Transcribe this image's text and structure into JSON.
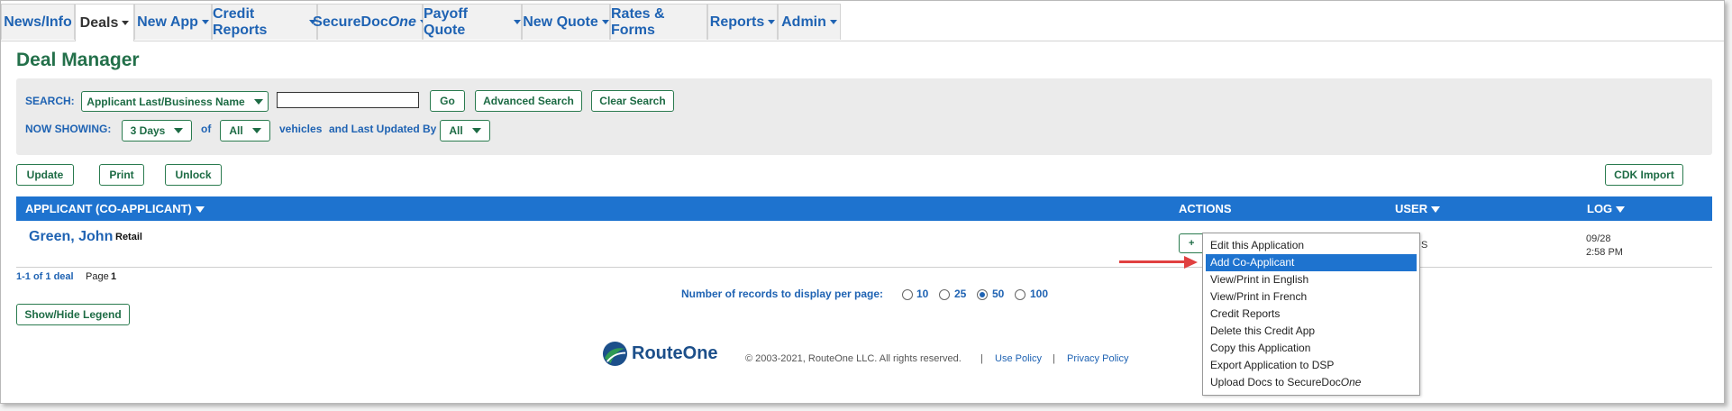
{
  "nav": {
    "tabs": [
      {
        "label": "News/Info",
        "caret": false,
        "active": false
      },
      {
        "label": "Deals",
        "caret": true,
        "active": true
      },
      {
        "label": "New App",
        "caret": true,
        "active": false
      },
      {
        "label": "Credit Reports",
        "caret": true,
        "active": false
      },
      {
        "label_prefix": "SecureDoc",
        "label_italic": "One",
        "caret": true,
        "active": false
      },
      {
        "label": "Payoff Quote",
        "caret": true,
        "active": false
      },
      {
        "label": "New Quote",
        "caret": true,
        "active": false
      },
      {
        "label": "Rates & Forms",
        "caret": false,
        "active": false
      },
      {
        "label": "Reports",
        "caret": true,
        "active": false
      },
      {
        "label": "Admin",
        "caret": true,
        "active": false
      }
    ]
  },
  "page": {
    "title": "Deal Manager"
  },
  "search": {
    "label": "SEARCH:",
    "field_selected": "Applicant Last/Business Name",
    "query_value": "",
    "go": "Go",
    "advanced": "Advanced Search",
    "clear": "Clear Search",
    "showing_label": "NOW SHOWING:",
    "days_selected": "3 Days",
    "of_label": "of",
    "vehicles_selected": "All",
    "vehicles_label": "vehicles",
    "updated_label": "and Last Updated By",
    "updated_by_selected": "All"
  },
  "toolbar": {
    "update": "Update",
    "print": "Print",
    "unlock": "Unlock",
    "cdk_import": "CDK Import"
  },
  "table": {
    "headers": {
      "applicant": "APPLICANT (CO-APPLICANT)",
      "actions": "ACTIONS",
      "user": "USER",
      "log": "LOG"
    },
    "rows": [
      {
        "applicant": "Green, John",
        "type": "Retail",
        "user": "US",
        "log_date": "09/28",
        "log_time": "2:58 PM"
      }
    ]
  },
  "action_button_partial": "+",
  "context_menu": {
    "items": [
      {
        "label": "Edit this Application"
      },
      {
        "label": "Add Co-Applicant",
        "highlighted": true
      },
      {
        "label": "View/Print in English"
      },
      {
        "label": "View/Print in French"
      },
      {
        "label": "Credit Reports"
      },
      {
        "label": "Delete this Credit App"
      },
      {
        "label": "Copy this Application"
      },
      {
        "label": "Export Application to DSP"
      },
      {
        "label_prefix": "Upload Docs to SecureDoc",
        "label_italic": "One"
      }
    ]
  },
  "pagination": {
    "count": "1-1 of 1 deal",
    "page_label": "Page",
    "page_number": "1"
  },
  "records": {
    "label": "Number of records to display per page:",
    "options": [
      "10",
      "25",
      "50",
      "100"
    ],
    "selected": "50"
  },
  "legend_button": "Show/Hide Legend",
  "footer": {
    "logo_text": "RouteOne",
    "copyright": "© 2003-2021, RouteOne LLC. All rights reserved.",
    "separator": "|",
    "use_policy": "Use Policy",
    "privacy_policy": "Privacy Policy"
  },
  "colors": {
    "nav_text": "#1f63b3",
    "title": "#23704a",
    "header_bg": "#1e73cf",
    "button_border": "#2a7b4f",
    "highlight": "#1e73cf",
    "annotation_arrow": "#e04040"
  }
}
